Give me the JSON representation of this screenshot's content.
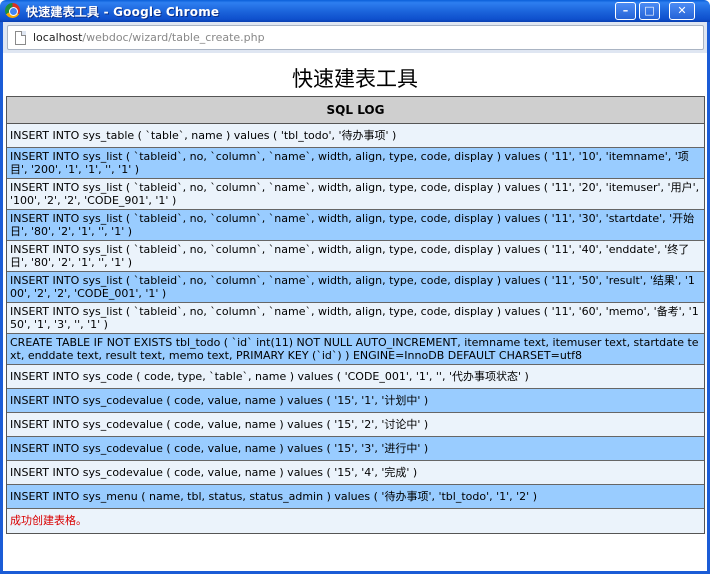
{
  "window": {
    "title": "快速建表工具 - Google Chrome",
    "minimize_glyph": "–",
    "maximize_glyph": "□",
    "close_glyph": "✕"
  },
  "address": {
    "host": "localhost",
    "path": "/webdoc/wizard/table_create.php"
  },
  "page": {
    "title": "快速建表工具",
    "log_header": "SQL LOG"
  },
  "log_rows": [
    "INSERT INTO sys_table ( `table`, name ) values ( 'tbl_todo', '待办事项' )",
    "INSERT INTO sys_list ( `tableid`, no, `column`, `name`, width, align, type, code, display ) values ( '11', '10', 'itemname', '项目', '200', '1', '1', '', '1' )",
    "INSERT INTO sys_list ( `tableid`, no, `column`, `name`, width, align, type, code, display ) values ( '11', '20', 'itemuser', '用户', '100', '2', '2', 'CODE_901', '1' )",
    "INSERT INTO sys_list ( `tableid`, no, `column`, `name`, width, align, type, code, display ) values ( '11', '30', 'startdate', '开始日', '80', '2', '1', '', '1' )",
    "INSERT INTO sys_list ( `tableid`, no, `column`, `name`, width, align, type, code, display ) values ( '11', '40', 'enddate', '终了日', '80', '2', '1', '', '1' )",
    "INSERT INTO sys_list ( `tableid`, no, `column`, `name`, width, align, type, code, display ) values ( '11', '50', 'result', '结果', '100', '2', '2', 'CODE_001', '1' )",
    "INSERT INTO sys_list ( `tableid`, no, `column`, `name`, width, align, type, code, display ) values ( '11', '60', 'memo', '备考', '150', '1', '3', '', '1' )",
    "CREATE TABLE IF NOT EXISTS tbl_todo ( `id` int(11) NOT NULL AUTO_INCREMENT, itemname text, itemuser text, startdate text, enddate text, result text, memo text, PRIMARY KEY (`id`) ) ENGINE=InnoDB DEFAULT CHARSET=utf8",
    "INSERT INTO sys_code ( code, type, `table`, name ) values ( 'CODE_001', '1', '', '代办事项状态' )",
    "INSERT INTO sys_codevalue ( code, value, name ) values ( '15', '1', '计划中' )",
    "INSERT INTO sys_codevalue ( code, value, name ) values ( '15', '2', '讨论中' )",
    "INSERT INTO sys_codevalue ( code, value, name ) values ( '15', '3', '进行中' )",
    "INSERT INTO sys_codevalue ( code, value, name ) values ( '15', '4', '完成' )",
    "INSERT INTO sys_menu ( name, tbl, status, status_admin ) values ( '待办事项', 'tbl_todo', '1', '2' )"
  ],
  "success_message": "成功创建表格。",
  "colors": {
    "row_odd": "#ebf3fb",
    "row_even": "#99ccff",
    "header_bg": "#cfcfcf",
    "success_text": "#d90000",
    "titlebar": "#1c65dc"
  }
}
